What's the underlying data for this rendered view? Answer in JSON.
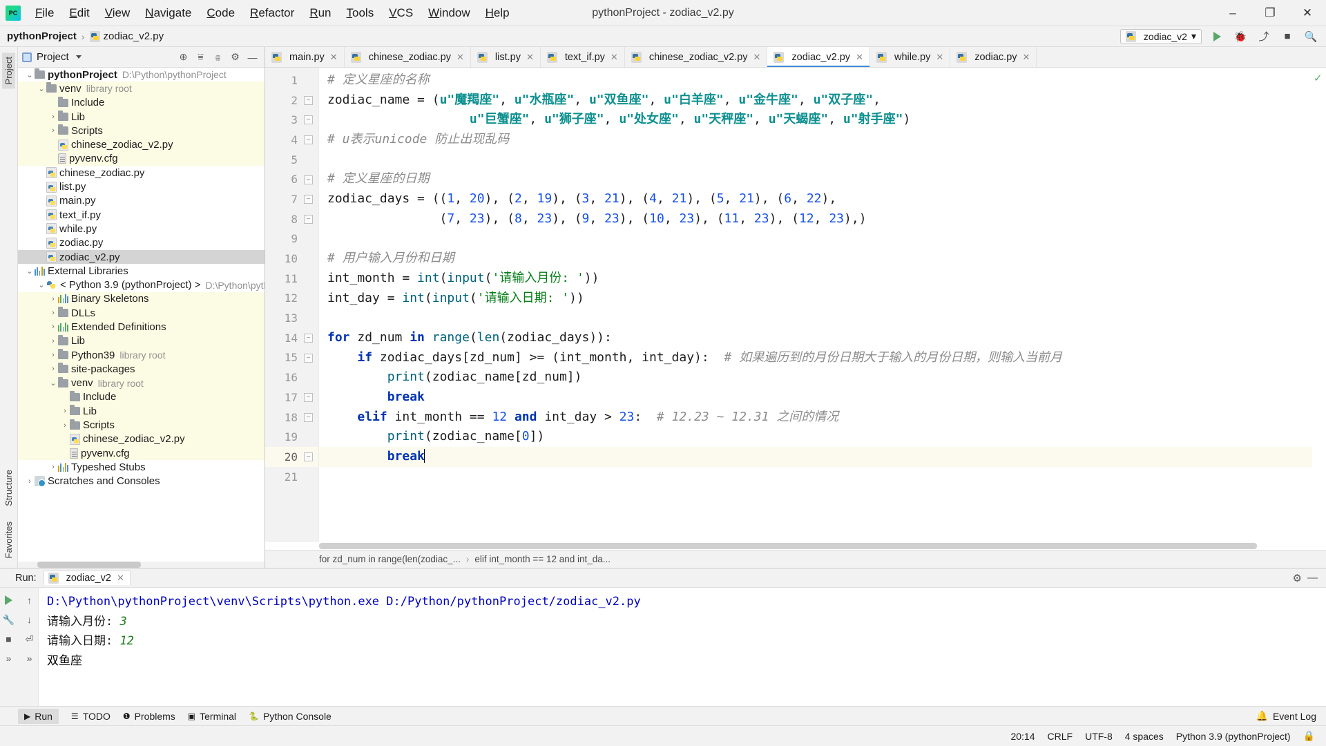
{
  "titlebar": {
    "logo": "pycharm-logo",
    "menus": [
      "File",
      "Edit",
      "View",
      "Navigate",
      "Code",
      "Refactor",
      "Run",
      "Tools",
      "VCS",
      "Window",
      "Help"
    ],
    "window_title": "pythonProject - zodiac_v2.py",
    "minimize": "–",
    "maximize": "❐",
    "close": "✕"
  },
  "navbar": {
    "project_name": "pythonProject",
    "separator": "›",
    "file_name": "zodiac_v2.py",
    "run_config": "zodiac_v2",
    "run_config_caret": "▾",
    "actions": [
      "run-button",
      "debug-button",
      "coverage-button",
      "stop-button",
      "search-everywhere-button"
    ]
  },
  "left_strip": {
    "project_tab": "Project",
    "structure_tab": "Structure",
    "favorites_tab": "Favorites"
  },
  "project_panel": {
    "title": "Project",
    "caret": "▾",
    "actions": [
      "locate-icon",
      "expand-all-icon",
      "collapse-all-icon",
      "settings-icon",
      "hide-icon"
    ],
    "tree": [
      {
        "depth": 0,
        "arrow": "⌄",
        "icon": "folder",
        "label": "pythonProject",
        "bold": true,
        "sub": "D:\\Python\\pythonProject",
        "hl": false,
        "sel": false
      },
      {
        "depth": 1,
        "arrow": "⌄",
        "icon": "folder",
        "label": "venv",
        "sub": "library root",
        "hl": true
      },
      {
        "depth": 2,
        "arrow": "",
        "icon": "folder",
        "label": "Include",
        "sub": "",
        "hl": true
      },
      {
        "depth": 2,
        "arrow": "›",
        "icon": "folder",
        "label": "Lib",
        "sub": "",
        "hl": true
      },
      {
        "depth": 2,
        "arrow": "›",
        "icon": "folder",
        "label": "Scripts",
        "sub": "",
        "hl": true
      },
      {
        "depth": 2,
        "arrow": "",
        "icon": "pyfile",
        "label": "chinese_zodiac_v2.py",
        "sub": "",
        "hl": true
      },
      {
        "depth": 2,
        "arrow": "",
        "icon": "cfg",
        "label": "pyvenv.cfg",
        "sub": "",
        "hl": true
      },
      {
        "depth": 1,
        "arrow": "",
        "icon": "pyfile",
        "label": "chinese_zodiac.py",
        "sub": "",
        "hl": false
      },
      {
        "depth": 1,
        "arrow": "",
        "icon": "pyfile",
        "label": "list.py",
        "sub": "",
        "hl": false
      },
      {
        "depth": 1,
        "arrow": "",
        "icon": "pyfile",
        "label": "main.py",
        "sub": "",
        "hl": false
      },
      {
        "depth": 1,
        "arrow": "",
        "icon": "pyfile",
        "label": "text_if.py",
        "sub": "",
        "hl": false
      },
      {
        "depth": 1,
        "arrow": "",
        "icon": "pyfile",
        "label": "while.py",
        "sub": "",
        "hl": false
      },
      {
        "depth": 1,
        "arrow": "",
        "icon": "pyfile",
        "label": "zodiac.py",
        "sub": "",
        "hl": false
      },
      {
        "depth": 1,
        "arrow": "",
        "icon": "pyfile",
        "label": "zodiac_v2.py",
        "sub": "",
        "hl": false,
        "sel": true
      },
      {
        "depth": 0,
        "arrow": "⌄",
        "icon": "bars",
        "label": "External Libraries",
        "sub": "",
        "hl": false
      },
      {
        "depth": 1,
        "arrow": "⌄",
        "icon": "snake",
        "label": "< Python 3.9 (pythonProject) >",
        "sub": "D:\\Python\\python",
        "hl": false
      },
      {
        "depth": 2,
        "arrow": "›",
        "icon": "bars",
        "label": "Binary Skeletons",
        "sub": "",
        "hl": true
      },
      {
        "depth": 2,
        "arrow": "›",
        "icon": "folder",
        "label": "DLLs",
        "sub": "",
        "hl": true
      },
      {
        "depth": 2,
        "arrow": "›",
        "icon": "bars",
        "label": "Extended Definitions",
        "sub": "",
        "hl": true
      },
      {
        "depth": 2,
        "arrow": "›",
        "icon": "folder",
        "label": "Lib",
        "sub": "",
        "hl": true
      },
      {
        "depth": 2,
        "arrow": "›",
        "icon": "folder",
        "label": "Python39",
        "sub": "library root",
        "hl": true
      },
      {
        "depth": 2,
        "arrow": "›",
        "icon": "folder",
        "label": "site-packages",
        "sub": "",
        "hl": true
      },
      {
        "depth": 2,
        "arrow": "⌄",
        "icon": "folder",
        "label": "venv",
        "sub": "library root",
        "hl": true
      },
      {
        "depth": 3,
        "arrow": "",
        "icon": "folder",
        "label": "Include",
        "sub": "",
        "hl": true
      },
      {
        "depth": 3,
        "arrow": "›",
        "icon": "folder",
        "label": "Lib",
        "sub": "",
        "hl": true
      },
      {
        "depth": 3,
        "arrow": "›",
        "icon": "folder",
        "label": "Scripts",
        "sub": "",
        "hl": true
      },
      {
        "depth": 3,
        "arrow": "",
        "icon": "pyfile",
        "label": "chinese_zodiac_v2.py",
        "sub": "",
        "hl": true
      },
      {
        "depth": 3,
        "arrow": "",
        "icon": "cfg",
        "label": "pyvenv.cfg",
        "sub": "",
        "hl": true
      },
      {
        "depth": 2,
        "arrow": "›",
        "icon": "bars",
        "label": "Typeshed Stubs",
        "sub": "",
        "hl": false
      },
      {
        "depth": 0,
        "arrow": "›",
        "icon": "scratch",
        "label": "Scratches and Consoles",
        "sub": "",
        "hl": false
      }
    ]
  },
  "editor": {
    "tabs": [
      {
        "label": "main.py",
        "selected": false
      },
      {
        "label": "chinese_zodiac.py",
        "selected": false
      },
      {
        "label": "list.py",
        "selected": false
      },
      {
        "label": "text_if.py",
        "selected": false
      },
      {
        "label": "chinese_zodiac_v2.py",
        "selected": false
      },
      {
        "label": "zodiac_v2.py",
        "selected": true
      },
      {
        "label": "while.py",
        "selected": false
      },
      {
        "label": "zodiac.py",
        "selected": false
      }
    ],
    "tab_close": "✕",
    "inspection_ok": "✓",
    "line_numbers": [
      1,
      2,
      3,
      4,
      5,
      6,
      7,
      8,
      9,
      10,
      11,
      12,
      13,
      14,
      15,
      16,
      17,
      18,
      19,
      20,
      21
    ],
    "current_line": 20,
    "breadcrumbs": [
      "for zd_num in range(len(zodiac_...",
      "elif int_month == 12 and int_da..."
    ],
    "breadcrumb_sep": "›"
  },
  "code_lines": [
    {
      "n": 1,
      "fold": "",
      "tokens": [
        {
          "t": "cmt",
          "v": "# 定义星座的名称"
        }
      ]
    },
    {
      "n": 2,
      "fold": "-",
      "tokens": [
        {
          "t": "plain",
          "v": "zodiac_name = ("
        },
        {
          "t": "ustr",
          "v": "u\"魔羯座\""
        },
        {
          "t": "plain",
          "v": ", "
        },
        {
          "t": "ustr",
          "v": "u\"水瓶座\""
        },
        {
          "t": "plain",
          "v": ", "
        },
        {
          "t": "ustr",
          "v": "u\"双鱼座\""
        },
        {
          "t": "plain",
          "v": ", "
        },
        {
          "t": "ustr",
          "v": "u\"白羊座\""
        },
        {
          "t": "plain",
          "v": ", "
        },
        {
          "t": "ustr",
          "v": "u\"金牛座\""
        },
        {
          "t": "plain",
          "v": ", "
        },
        {
          "t": "ustr",
          "v": "u\"双子座\""
        },
        {
          "t": "plain",
          "v": ","
        }
      ]
    },
    {
      "n": 3,
      "fold": "-",
      "tokens": [
        {
          "t": "plain",
          "v": "                   "
        },
        {
          "t": "ustr",
          "v": "u\"巨蟹座\""
        },
        {
          "t": "plain",
          "v": ", "
        },
        {
          "t": "ustr",
          "v": "u\"狮子座\""
        },
        {
          "t": "plain",
          "v": ", "
        },
        {
          "t": "ustr",
          "v": "u\"处女座\""
        },
        {
          "t": "plain",
          "v": ", "
        },
        {
          "t": "ustr",
          "v": "u\"天秤座\""
        },
        {
          "t": "plain",
          "v": ", "
        },
        {
          "t": "ustr",
          "v": "u\"天蝎座\""
        },
        {
          "t": "plain",
          "v": ", "
        },
        {
          "t": "ustr",
          "v": "u\"射手座\""
        },
        {
          "t": "plain",
          "v": ")"
        }
      ]
    },
    {
      "n": 4,
      "fold": "v",
      "tokens": [
        {
          "t": "cmt",
          "v": "# u表示unicode 防止出现乱码"
        }
      ]
    },
    {
      "n": 5,
      "fold": "",
      "tokens": []
    },
    {
      "n": 6,
      "fold": "-",
      "tokens": [
        {
          "t": "cmt",
          "v": "# 定义星座的日期"
        }
      ]
    },
    {
      "n": 7,
      "fold": "-",
      "tokens": [
        {
          "t": "plain",
          "v": "zodiac_days = (("
        },
        {
          "t": "num",
          "v": "1"
        },
        {
          "t": "plain",
          "v": ", "
        },
        {
          "t": "num",
          "v": "20"
        },
        {
          "t": "plain",
          "v": "), ("
        },
        {
          "t": "num",
          "v": "2"
        },
        {
          "t": "plain",
          "v": ", "
        },
        {
          "t": "num",
          "v": "19"
        },
        {
          "t": "plain",
          "v": "), ("
        },
        {
          "t": "num",
          "v": "3"
        },
        {
          "t": "plain",
          "v": ", "
        },
        {
          "t": "num",
          "v": "21"
        },
        {
          "t": "plain",
          "v": "), ("
        },
        {
          "t": "num",
          "v": "4"
        },
        {
          "t": "plain",
          "v": ", "
        },
        {
          "t": "num",
          "v": "21"
        },
        {
          "t": "plain",
          "v": "), ("
        },
        {
          "t": "num",
          "v": "5"
        },
        {
          "t": "plain",
          "v": ", "
        },
        {
          "t": "num",
          "v": "21"
        },
        {
          "t": "plain",
          "v": "), ("
        },
        {
          "t": "num",
          "v": "6"
        },
        {
          "t": "plain",
          "v": ", "
        },
        {
          "t": "num",
          "v": "22"
        },
        {
          "t": "plain",
          "v": "),"
        }
      ]
    },
    {
      "n": 8,
      "fold": "-",
      "tokens": [
        {
          "t": "plain",
          "v": "               ("
        },
        {
          "t": "num",
          "v": "7"
        },
        {
          "t": "plain",
          "v": ", "
        },
        {
          "t": "num",
          "v": "23"
        },
        {
          "t": "plain",
          "v": "), ("
        },
        {
          "t": "num",
          "v": "8"
        },
        {
          "t": "plain",
          "v": ", "
        },
        {
          "t": "num",
          "v": "23"
        },
        {
          "t": "plain",
          "v": "), ("
        },
        {
          "t": "num",
          "v": "9"
        },
        {
          "t": "plain",
          "v": ", "
        },
        {
          "t": "num",
          "v": "23"
        },
        {
          "t": "plain",
          "v": "), ("
        },
        {
          "t": "num",
          "v": "10"
        },
        {
          "t": "plain",
          "v": ", "
        },
        {
          "t": "num",
          "v": "23"
        },
        {
          "t": "plain",
          "v": "), ("
        },
        {
          "t": "num",
          "v": "11"
        },
        {
          "t": "plain",
          "v": ", "
        },
        {
          "t": "num",
          "v": "23"
        },
        {
          "t": "plain",
          "v": "), ("
        },
        {
          "t": "num",
          "v": "12"
        },
        {
          "t": "plain",
          "v": ", "
        },
        {
          "t": "num",
          "v": "23"
        },
        {
          "t": "plain",
          "v": "),)"
        }
      ]
    },
    {
      "n": 9,
      "fold": "",
      "tokens": []
    },
    {
      "n": 10,
      "fold": "",
      "tokens": [
        {
          "t": "cmt",
          "v": "# 用户输入月份和日期"
        }
      ]
    },
    {
      "n": 11,
      "fold": "",
      "tokens": [
        {
          "t": "plain",
          "v": "int_month = "
        },
        {
          "t": "fn",
          "v": "int"
        },
        {
          "t": "plain",
          "v": "("
        },
        {
          "t": "fn",
          "v": "input"
        },
        {
          "t": "plain",
          "v": "("
        },
        {
          "t": "str",
          "v": "'请输入月份: '"
        },
        {
          "t": "plain",
          "v": "))"
        }
      ]
    },
    {
      "n": 12,
      "fold": "",
      "tokens": [
        {
          "t": "plain",
          "v": "int_day = "
        },
        {
          "t": "fn",
          "v": "int"
        },
        {
          "t": "plain",
          "v": "("
        },
        {
          "t": "fn",
          "v": "input"
        },
        {
          "t": "plain",
          "v": "("
        },
        {
          "t": "str",
          "v": "'请输入日期: '"
        },
        {
          "t": "plain",
          "v": "))"
        }
      ]
    },
    {
      "n": 13,
      "fold": "",
      "tokens": []
    },
    {
      "n": 14,
      "fold": "-",
      "tokens": [
        {
          "t": "kw",
          "v": "for"
        },
        {
          "t": "plain",
          "v": " zd_num "
        },
        {
          "t": "kw",
          "v": "in"
        },
        {
          "t": "plain",
          "v": " "
        },
        {
          "t": "fn",
          "v": "range"
        },
        {
          "t": "plain",
          "v": "("
        },
        {
          "t": "fn",
          "v": "len"
        },
        {
          "t": "plain",
          "v": "(zodiac_days)):"
        }
      ]
    },
    {
      "n": 15,
      "fold": "-",
      "tokens": [
        {
          "t": "plain",
          "v": "    "
        },
        {
          "t": "kw",
          "v": "if"
        },
        {
          "t": "plain",
          "v": " zodiac_days[zd_num] >= (int_month, int_day):  "
        },
        {
          "t": "cmt",
          "v": "# 如果遍历到的月份日期大于输入的月份日期，则输入当前月"
        }
      ]
    },
    {
      "n": 16,
      "fold": "",
      "tokens": [
        {
          "t": "plain",
          "v": "        "
        },
        {
          "t": "fn",
          "v": "print"
        },
        {
          "t": "plain",
          "v": "(zodiac_name[zd_num])"
        }
      ]
    },
    {
      "n": 17,
      "fold": "-",
      "tokens": [
        {
          "t": "plain",
          "v": "        "
        },
        {
          "t": "kw",
          "v": "break"
        }
      ]
    },
    {
      "n": 18,
      "fold": "-",
      "tokens": [
        {
          "t": "plain",
          "v": "    "
        },
        {
          "t": "kw",
          "v": "elif"
        },
        {
          "t": "plain",
          "v": " int_month == "
        },
        {
          "t": "num",
          "v": "12"
        },
        {
          "t": "plain",
          "v": " "
        },
        {
          "t": "kw",
          "v": "and"
        },
        {
          "t": "plain",
          "v": " int_day > "
        },
        {
          "t": "num",
          "v": "23"
        },
        {
          "t": "plain",
          "v": ":  "
        },
        {
          "t": "cmt",
          "v": "# 12.23 ~ 12.31 之间的情况"
        }
      ]
    },
    {
      "n": 19,
      "fold": "",
      "tokens": [
        {
          "t": "plain",
          "v": "        "
        },
        {
          "t": "fn",
          "v": "print"
        },
        {
          "t": "plain",
          "v": "(zodiac_name["
        },
        {
          "t": "num",
          "v": "0"
        },
        {
          "t": "plain",
          "v": "])"
        }
      ]
    },
    {
      "n": 20,
      "fold": "-",
      "tokens": [
        {
          "t": "plain",
          "v": "        "
        },
        {
          "t": "kw",
          "v": "break"
        }
      ],
      "cursor": true
    },
    {
      "n": 21,
      "fold": "",
      "tokens": []
    }
  ],
  "run_panel": {
    "label": "Run:",
    "tab_name": "zodiac_v2",
    "tab_close": "✕",
    "toolbar_icons": [
      "rerun-icon",
      "scroll-up-icon",
      "wrench-icon",
      "stop-icon",
      "soft-wrap-icon",
      "print-icon",
      "expand-icon",
      "collapse-icon"
    ],
    "header_right_icons": [
      "settings-icon",
      "hide-icon"
    ],
    "console": [
      {
        "type": "path",
        "text": "D:\\Python\\pythonProject\\venv\\Scripts\\python.exe D:/Python/pythonProject/zodiac_v2.py"
      },
      {
        "type": "prompt",
        "prompt": "请输入月份: ",
        "input": "3"
      },
      {
        "type": "prompt",
        "prompt": "请输入日期: ",
        "input": "12"
      },
      {
        "type": "out",
        "text": "双鱼座"
      }
    ]
  },
  "toolwindow_bar": {
    "items": [
      {
        "label": "Run",
        "icon": "run-icon",
        "active": true
      },
      {
        "label": "TODO",
        "icon": "todo-icon",
        "active": false
      },
      {
        "label": "Problems",
        "icon": "problems-icon",
        "active": false
      },
      {
        "label": "Terminal",
        "icon": "terminal-icon",
        "active": false
      },
      {
        "label": "Python Console",
        "icon": "python-console-icon",
        "active": false
      }
    ],
    "event_log": "Event Log",
    "event_log_icon": "bell-icon"
  },
  "statusbar": {
    "caret_position": "20:14",
    "line_separator": "CRLF",
    "encoding": "UTF-8",
    "indent": "4 spaces",
    "interpreter": "Python 3.9 (pythonProject)",
    "lock_icon": "lock-icon"
  }
}
